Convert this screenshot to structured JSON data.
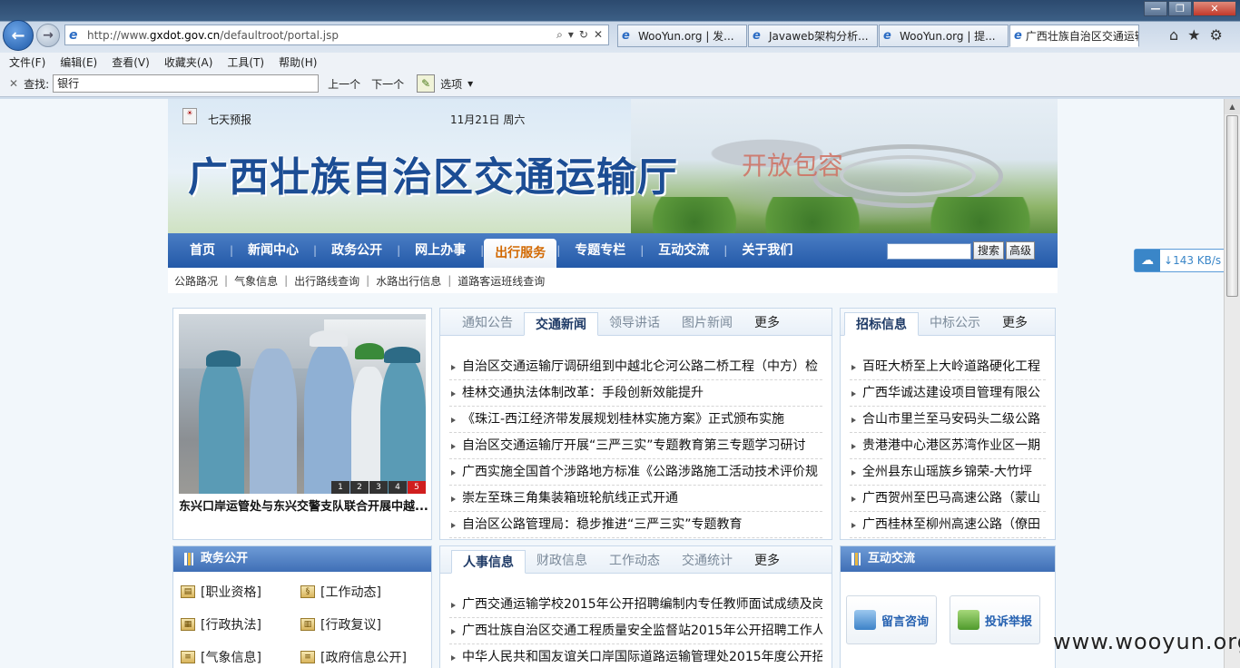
{
  "browser": {
    "address": {
      "url_prefix": "http://www.",
      "url_host": "gxdot.gov.cn",
      "url_path": "/defaultroot/portal.jsp"
    },
    "tabs": [
      {
        "title": "WooYun.org | 发..."
      },
      {
        "title": "Javaweb架构分析..."
      },
      {
        "title": "WooYun.org | 提..."
      },
      {
        "title": "广西壮族自治区交通运输厅"
      }
    ],
    "menu": [
      "文件(F)",
      "编辑(E)",
      "查看(V)",
      "收藏夹(A)",
      "工具(T)",
      "帮助(H)"
    ],
    "find": {
      "label": "查找:",
      "value": "银行",
      "prev": "上一个",
      "next": "下一个",
      "options": "选项"
    }
  },
  "site": {
    "forecast": "七天预报",
    "date": "11月21日  周六",
    "title": "广西壮族自治区交通运输厅",
    "slogan": "开放包容",
    "nav": [
      "首页",
      "新闻中心",
      "政务公开",
      "网上办事",
      "出行服务",
      "专题专栏",
      "互动交流",
      "关于我们"
    ],
    "nav_search_btn": "搜索",
    "nav_adv_btn": "高级",
    "subnav": [
      "公路路况",
      "气象信息",
      "出行路线查询",
      "水路出行信息",
      "道路客运班线查询"
    ]
  },
  "photo": {
    "caption": "东兴口岸运管处与东兴交警支队联合开展中越...",
    "pages": [
      "1",
      "2",
      "3",
      "4",
      "5"
    ]
  },
  "news_panel": {
    "tabs": [
      "通知公告",
      "交通新闻",
      "领导讲话",
      "图片新闻",
      "更多"
    ],
    "items": [
      "自治区交通运输厅调研组到中越北仑河公路二桥工程（中方）检",
      "桂林交通执法体制改革：手段创新效能提升",
      "《珠江-西江经济带发展规划桂林实施方案》正式颁布实施",
      "自治区交通运输厅开展“三严三实”专题教育第三专题学习研讨",
      "广西实施全国首个涉路地方标准《公路涉路施工活动技术评价规",
      "崇左至珠三角集装箱班轮航线正式开通",
      "自治区公路管理局：稳步推进“三严三实”专题教育"
    ]
  },
  "bid_panel": {
    "tabs": [
      "招标信息",
      "中标公示",
      "更多"
    ],
    "items": [
      "百旺大桥至上大岭道路硬化工程",
      "广西华诚达建设项目管理有限公",
      "合山市里兰至马安码头二级公路",
      "贵港港中心港区苏湾作业区一期",
      "全州县东山瑶族乡锦荣-大竹坪",
      "广西贺州至巴马高速公路（蒙山",
      "广西桂林至柳州高速公路（僚田"
    ]
  },
  "gov_panel": {
    "title": "政务公开",
    "items": [
      "[职业资格]",
      "[工作动态]",
      "[行政执法]",
      "[行政复议]",
      "[气象信息]",
      "[政府信息公开]"
    ]
  },
  "hr_panel": {
    "tabs": [
      "人事信息",
      "财政信息",
      "工作动态",
      "交通统计",
      "更多"
    ],
    "items": [
      "广西交通运输学校2015年公开招聘编制内专任教师面试成绩及岗",
      "广西壮族自治区交通工程质量安全监督站2015年公开招聘工作人",
      "中华人民共和国友谊关口岸国际道路运输管理处2015年度公开招"
    ]
  },
  "interact_panel": {
    "title": "互动交流",
    "buttons": [
      "留言咨询",
      "投诉举报"
    ]
  },
  "overlay": {
    "speed": "143 KB/s",
    "watermark": "www.wooyun.org"
  }
}
